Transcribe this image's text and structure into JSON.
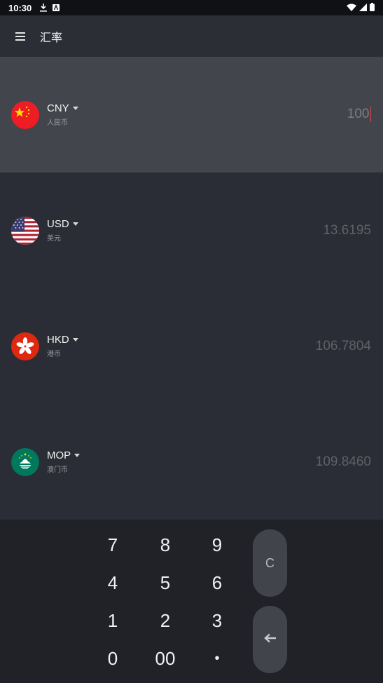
{
  "status_bar": {
    "time": "10:30"
  },
  "app_bar": {
    "title": "汇率"
  },
  "currencies": [
    {
      "code": "CNY",
      "name": "人民币",
      "amount": "100",
      "flag": "china-flag-icon"
    },
    {
      "code": "USD",
      "name": "美元",
      "amount": "13.6195",
      "flag": "usa-flag-icon"
    },
    {
      "code": "HKD",
      "name": "港币",
      "amount": "106.7804",
      "flag": "hongkong-flag-icon"
    },
    {
      "code": "MOP",
      "name": "澳门币",
      "amount": "109.8460",
      "flag": "macau-flag-icon"
    }
  ],
  "keypad": {
    "keys": [
      "7",
      "8",
      "9",
      "4",
      "5",
      "6",
      "1",
      "2",
      "3",
      "0",
      "00",
      "•"
    ],
    "clear_label": "C",
    "backspace_icon": "backspace-arrow-icon"
  },
  "colors": {
    "background": "#2a2d35",
    "active_row": "#42454b",
    "keypad_bg": "#202227",
    "cursor": "#e0443e"
  }
}
